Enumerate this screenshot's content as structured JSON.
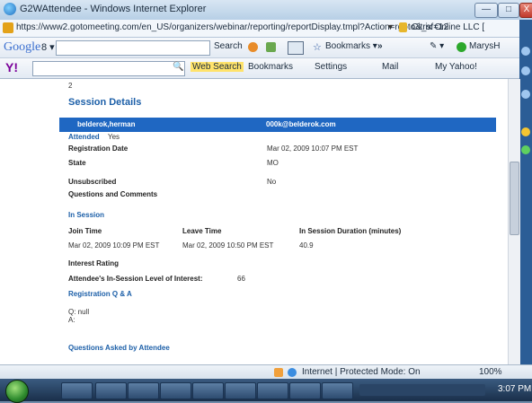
{
  "window": {
    "title": "G2WAttendee - Windows Internet Explorer",
    "url": "https://www2.gotomeeting.com/en_US/organizers/webinar/reporting/reportDisplay.tmpl?Action=rgoto&_sf=12",
    "cert_label": "Citrix Online LLC [",
    "controls": [
      "—",
      "□",
      "X"
    ]
  },
  "google_toolbar": {
    "logo": "Google",
    "logo_suffix": "8 ▾",
    "search_label": "Search",
    "bookmarks_label": "Bookmarks ▾",
    "more_label": "»",
    "user_label": "MarysH"
  },
  "yahoo_toolbar": {
    "logo": "Y!",
    "web_search_label": "Web Search",
    "bookmarks_label": "Bookmarks",
    "settings_label": "Settings",
    "mail_label": "Mail",
    "my_yahoo_label": "My Yahoo!"
  },
  "content": {
    "row_number": "2",
    "session_title": "Session Details",
    "attendee_name": "belderok,herman",
    "attendee_email": "000k@belderok.com",
    "attended_label": "Attended",
    "attended_value": "Yes",
    "fields": [
      {
        "label": "Registration Date",
        "value": "Mar 02, 2009 10:07 PM EST"
      },
      {
        "label": "State",
        "value": "MO"
      },
      {
        "label": "Unsubscribed",
        "value": "No"
      }
    ],
    "questions_comments_label": "Questions and Comments",
    "in_session_label": "In Session",
    "session_table": {
      "headers": [
        "Join Time",
        "Leave Time",
        "In Session Duration (minutes)"
      ],
      "row": [
        "Mar 02, 2009 10:09 PM EST",
        "Mar 02, 2009 10:50 PM EST",
        "40.9"
      ]
    },
    "interest_rating_label": "Interest Rating",
    "interest_level_label": "Attendee's In-Session Level of Interest:",
    "interest_level_value": "66",
    "registration_qa_label": "Registration Q & A",
    "q_text": "Q: null",
    "a_text": "A:",
    "questions_asked_label": "Questions Asked by Attendee"
  },
  "status_bar": {
    "zone": "Internet | Protected Mode: On",
    "zoom": "100%"
  },
  "taskbar": {
    "clock": "3:07 PM"
  }
}
